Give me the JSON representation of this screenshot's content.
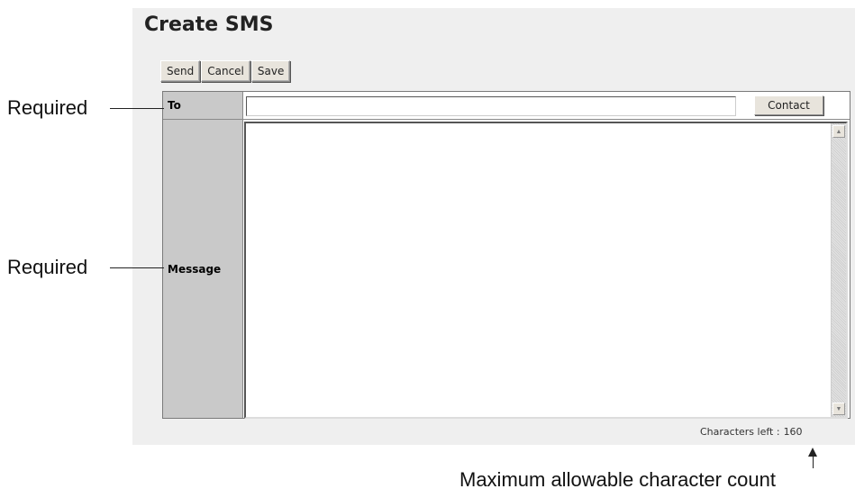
{
  "window": {
    "title": "Create SMS"
  },
  "toolbar": {
    "send_label": "Send",
    "cancel_label": "Cancel",
    "save_label": "Save"
  },
  "form": {
    "to_label": "To",
    "to_value": "",
    "contact_label": "Contact",
    "message_label": "Message",
    "message_value": ""
  },
  "status": {
    "chars_left_label": "Characters left :",
    "chars_left_value": "160"
  },
  "annotations": {
    "required_to": "Required",
    "required_message": "Required",
    "max_count": "Maximum allowable character count"
  },
  "colors": {
    "panel_bg": "#efefef",
    "label_bg": "#c9c9c9",
    "button_bg": "#e8e4dc"
  },
  "icons": {
    "scroll_up": "scroll-up-arrow-icon",
    "scroll_down": "scroll-down-arrow-icon"
  }
}
